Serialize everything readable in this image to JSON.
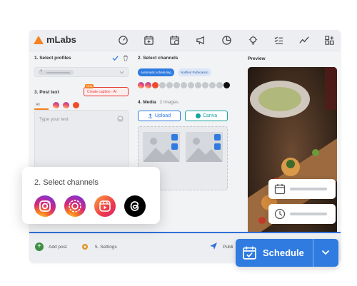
{
  "app": {
    "brand": "mLabs"
  },
  "colors": {
    "accent": "#2f7be0",
    "brand_orange": "#f58220",
    "caption_red": "#e53935",
    "canva_teal": "#16a6a0"
  },
  "nav_icons": [
    "gauge-icon",
    "calendar-add-icon",
    "calendar-clock-icon",
    "megaphone-icon",
    "pie-chart-icon",
    "lightbulb-icon",
    "checklist-icon",
    "trend-icon",
    "grid-plus-icon"
  ],
  "profiles": {
    "title": "1. Select profiles"
  },
  "post_text": {
    "title": "3. Post text",
    "tab_all": "All",
    "placeholder": "Type your text",
    "caption_button": "Create caption - AI",
    "new_badge": "NEW"
  },
  "channels": {
    "title": "2. Select channels",
    "chip_auto": "Automatic scheduling",
    "chip_notified": "Notified Publication"
  },
  "media": {
    "title": "4. Media",
    "count": "2 images",
    "upload_label": "Upload",
    "canva_label": "Canva"
  },
  "preview": {
    "title": "Preview"
  },
  "bottom": {
    "add_post": "Add post",
    "settings": "5. Settings",
    "publish_partial": "Publi"
  },
  "floating_channels": {
    "title": "2. Select channels"
  },
  "schedule": {
    "label": "Schedule"
  }
}
